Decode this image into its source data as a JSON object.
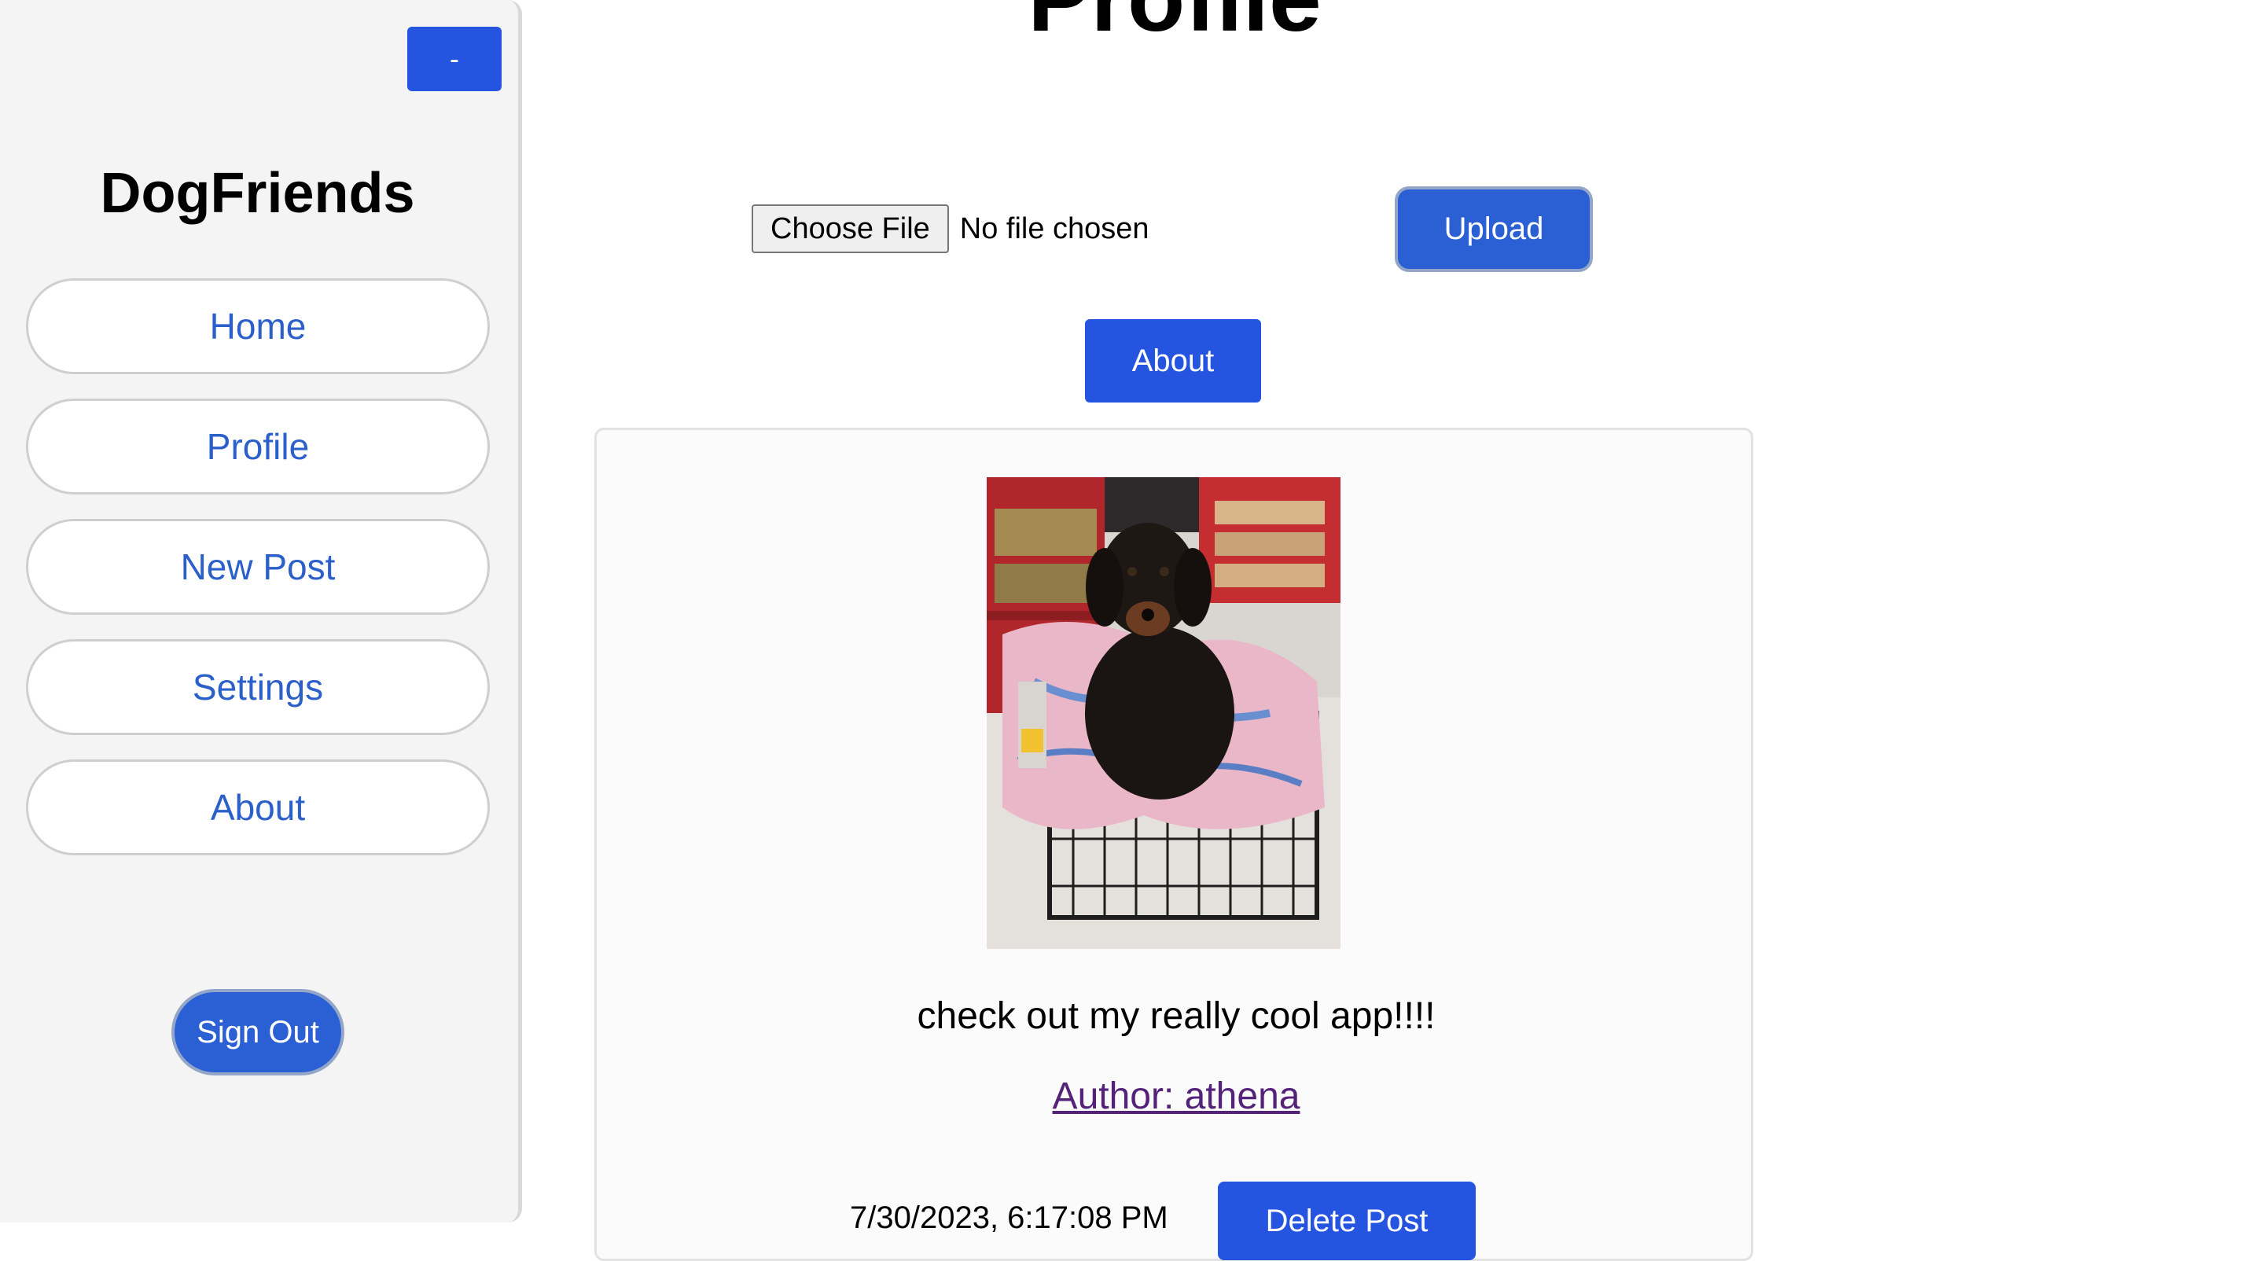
{
  "sidebar": {
    "collapse_label": "-",
    "brand": "DogFriends",
    "items": [
      {
        "label": "Home"
      },
      {
        "label": "Profile"
      },
      {
        "label": "New Post"
      },
      {
        "label": "Settings"
      },
      {
        "label": "About"
      }
    ],
    "sign_out_label": "Sign Out"
  },
  "main": {
    "title": "Profile",
    "file_input": {
      "button_label": "Choose File",
      "status": "No file chosen"
    },
    "upload_label": "Upload",
    "about_label": "About"
  },
  "post": {
    "image_icon": "dog-photo",
    "caption": "check out my really cool app!!!!",
    "author": "Author: athena",
    "timestamp": "7/30/2023, 6:17:08 PM",
    "delete_label": "Delete Post"
  },
  "colors": {
    "primary_blue": "#2554e0",
    "link_blue": "#2b5fc9",
    "visited_link": "#55227a",
    "sidebar_bg": "#f4f4f4"
  }
}
